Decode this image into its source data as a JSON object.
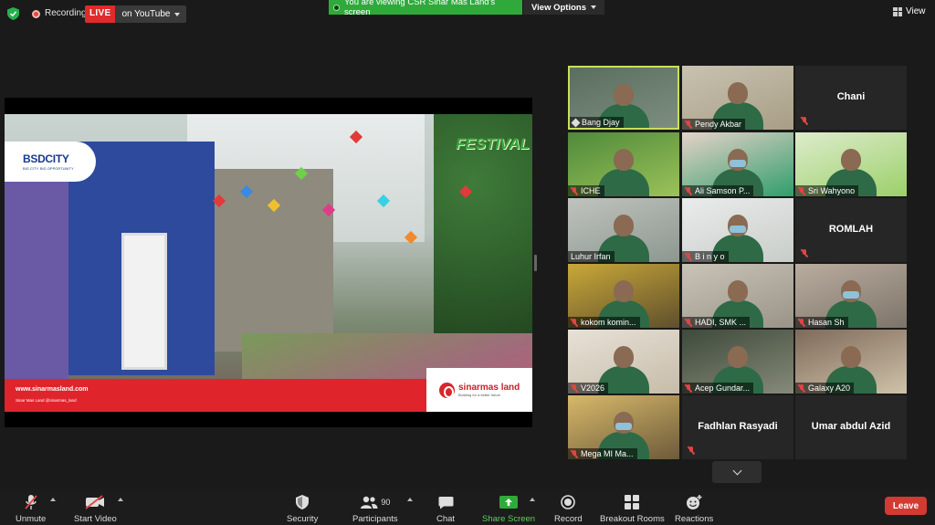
{
  "topbar": {
    "recording_label": "Recording",
    "live_badge": "LIVE",
    "youtube_label": "on YouTube",
    "share_banner": "You are viewing CSR Sinar Mas Land's screen",
    "view_options": "View Options",
    "view_label": "View"
  },
  "shared": {
    "logo_text": "BSDCITY",
    "logo_tagline": "BIG CITY. BIG OPPORTUNITY",
    "festival_text": "FESTIVAL",
    "website": "www.sinarmasland.com",
    "social": "Sinar Mas Land   @sinarmas_land",
    "brand_name": "sinarmas land",
    "brand_tagline": "Building for a better future"
  },
  "participants": [
    {
      "name": "Bang Djay",
      "video": true,
      "active": true,
      "pinned": true
    },
    {
      "name": "Pendy Akbar",
      "video": true,
      "muted": true
    },
    {
      "name": "Chani",
      "video": false,
      "muted": true
    },
    {
      "name": "ICHE",
      "video": true,
      "muted": true
    },
    {
      "name": "Ali Samson P...",
      "video": true,
      "muted": true
    },
    {
      "name": "Sri Wahyono",
      "video": true,
      "muted": true
    },
    {
      "name": "Luhur Irfan",
      "video": true
    },
    {
      "name": "B i n y o",
      "video": true,
      "muted": true
    },
    {
      "name": "ROMLAH",
      "video": false,
      "muted": true
    },
    {
      "name": "kokom komin...",
      "video": true,
      "muted": true
    },
    {
      "name": "HADI,  SMK ...",
      "video": true,
      "muted": true
    },
    {
      "name": "Hasan Sh",
      "video": true,
      "muted": true
    },
    {
      "name": "V2026",
      "video": true,
      "muted": true
    },
    {
      "name": "Acep Gundar...",
      "video": true,
      "muted": true
    },
    {
      "name": "Galaxy A20",
      "video": true,
      "muted": true
    },
    {
      "name": "Mega MI Ma...",
      "video": true,
      "muted": true
    },
    {
      "name": "Fadhlan Rasyadi",
      "video": false,
      "muted": true
    },
    {
      "name": "Umar abdul Azid",
      "video": false
    }
  ],
  "toolbar": {
    "unmute": "Unmute",
    "start_video": "Start Video",
    "security": "Security",
    "participants": "Participants",
    "participants_count": "90",
    "chat": "Chat",
    "share_screen": "Share Screen",
    "record": "Record",
    "breakout": "Breakout Rooms",
    "reactions": "Reactions",
    "leave": "Leave"
  },
  "colors": {
    "accent_green": "#2faa3a",
    "live_red": "#e02b2b",
    "active_speaker": "#c7e05a",
    "leave_red": "#d33a32",
    "mute_red": "#e24444"
  }
}
